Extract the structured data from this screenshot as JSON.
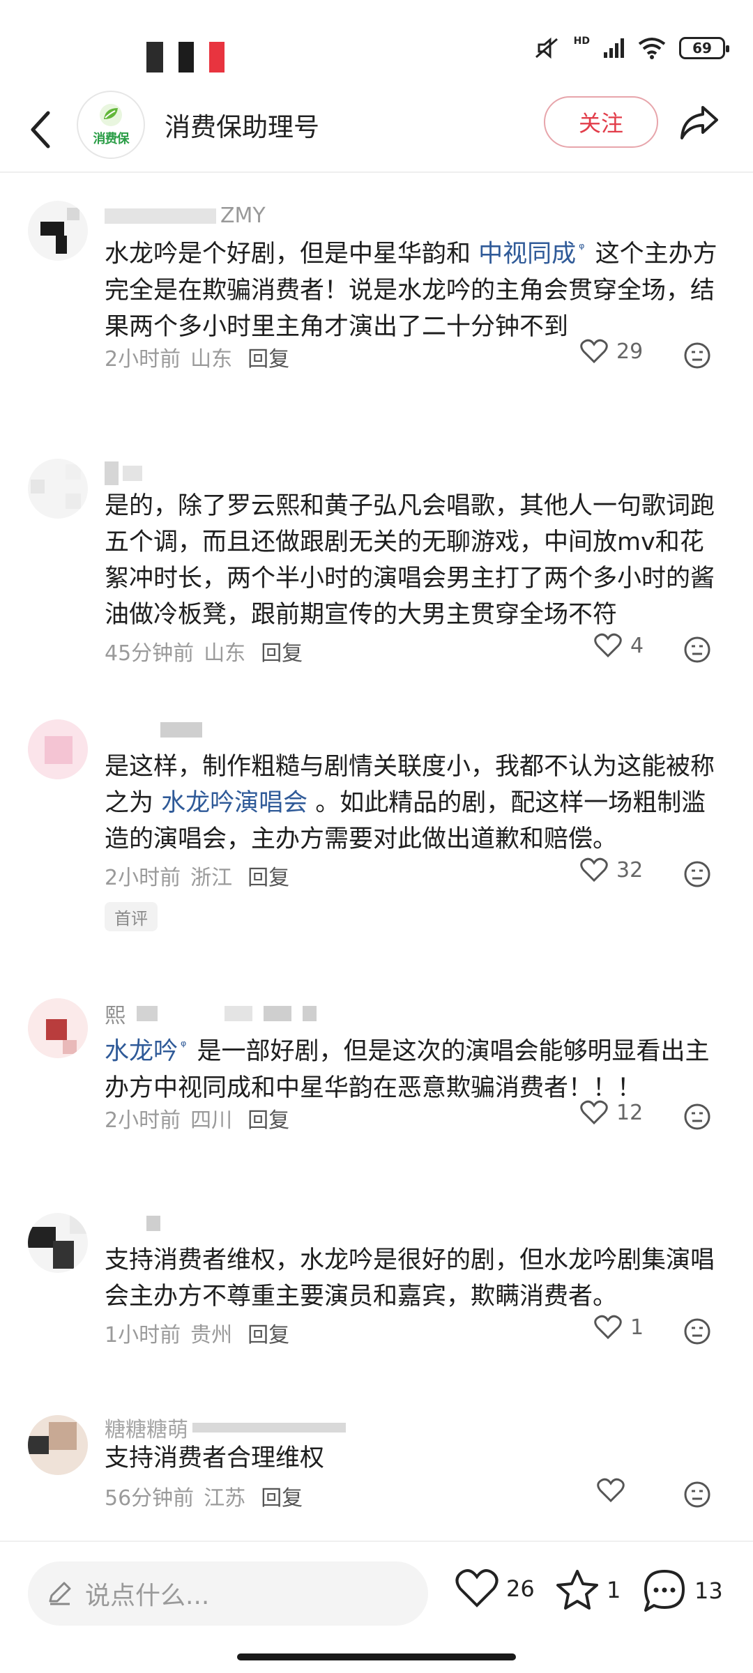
{
  "status_bar": {
    "network_label": "HD",
    "battery": "69",
    "mosaic_colors": [
      "#2b2b2b",
      "#1c1c1c",
      "#e8343f"
    ]
  },
  "header": {
    "account_name": "消费保助理号",
    "logo_text": "消费保",
    "follow_label": "关注",
    "accent_color": "#e23d4a"
  },
  "comments": [
    {
      "name": "ZMY",
      "text_parts": [
        {
          "t": "水龙吟是个好剧，但是中星华韵和 "
        },
        {
          "t": "中视同成",
          "topic": true
        },
        {
          "t": " 这个主办方完全是在欺骗消费者！说是水龙吟的主角会贯穿全场，结果两个多小时里主角才演出了二十分钟不到"
        }
      ],
      "time": "2小时前",
      "location": "山东",
      "reply": "回复",
      "likes": "29"
    },
    {
      "name": "",
      "text_parts": [
        {
          "t": "是的，除了罗云熙和黄子弘凡会唱歌，其他人一句歌词跑五个调，而且还做跟剧无关的无聊游戏，中间放mv和花絮冲时长，两个半小时的演唱会男主打了两个多小时的酱油做冷板凳，跟前期宣传的大男主贯穿全场不符"
        }
      ],
      "time": "45分钟前",
      "location": "山东",
      "reply": "回复",
      "likes": "4"
    },
    {
      "name": "",
      "text_parts": [
        {
          "t": "是这样，制作粗糙与剧情关联度小，我都不认为这能被称之为 "
        },
        {
          "t": "水龙吟演唱会",
          "topic": true
        },
        {
          "t": " 。如此精品的剧，配这样一场粗制滥造的演唱会，主办方需要对此做出道歉和赔偿。"
        }
      ],
      "time": "2小时前",
      "location": "浙江",
      "reply": "回复",
      "likes": "32",
      "badge": "首评"
    },
    {
      "name": "熙",
      "text_parts": [
        {
          "t": "水龙吟",
          "topic": true
        },
        {
          "t": " 是一部好剧，但是这次的演唱会能够明显看出主办方中视同成和中星华韵在恶意欺骗消费者！！！"
        }
      ],
      "time": "2小时前",
      "location": "四川",
      "reply": "回复",
      "likes": "12"
    },
    {
      "name": "",
      "text_parts": [
        {
          "t": "支持消费者维权，水龙吟是很好的剧，但水龙吟剧集演唱会主办方不尊重主要演员和嘉宾，欺瞒消费者。"
        }
      ],
      "time": "1小时前",
      "location": "贵州",
      "reply": "回复",
      "likes": "1"
    },
    {
      "name": "糖糖糖萌",
      "text_parts": [
        {
          "t": "支持消费者合理维权"
        }
      ],
      "time": "56分钟前",
      "location": "江苏",
      "reply": "回复",
      "likes": ""
    }
  ],
  "bottom_bar": {
    "input_placeholder": "说点什么...",
    "like_count": "26",
    "star_count": "1",
    "comment_count": "13"
  }
}
